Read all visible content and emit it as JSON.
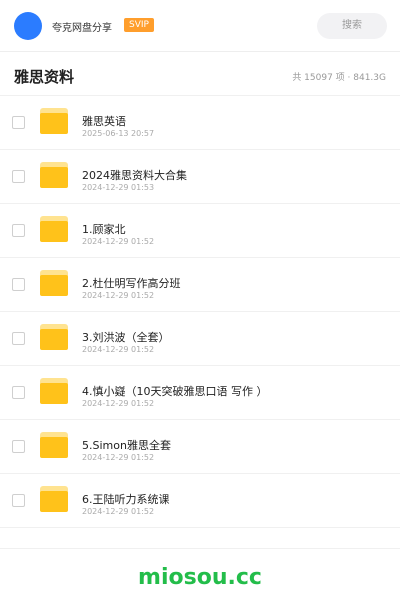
{
  "header": {
    "share_title": "夸克网盘分享",
    "svip_badge": "SVIP",
    "search_label": "搜索"
  },
  "title_bar": {
    "title": "雅思资料",
    "stats": "共 15097 项 · 841.3G"
  },
  "items": [
    {
      "name": "雅思英语",
      "date": "2025-06-13 20:57"
    },
    {
      "name": "2024雅思资料大合集",
      "date": "2024-12-29 01:53"
    },
    {
      "name": "1.顾家北",
      "date": "2024-12-29 01:52"
    },
    {
      "name": "2.杜仕明写作高分班",
      "date": "2024-12-29 01:52"
    },
    {
      "name": "3.刘洪波（全套）",
      "date": "2024-12-29 01:52"
    },
    {
      "name": "4.慎小嶷（10天突破雅思口语 写作 ）",
      "date": "2024-12-29 01:52"
    },
    {
      "name": "5.Simon雅思全套",
      "date": "2024-12-29 01:52"
    },
    {
      "name": "6.王陆听力系统课",
      "date": "2024-12-29 01:52"
    }
  ],
  "footer": {
    "brand": "miosou.cc",
    "brand_color": "#23bd4a"
  },
  "icons": {
    "avatar": "avatar",
    "folder": "folder-icon",
    "checkbox": "checkbox"
  },
  "colors": {
    "avatar": "#2b7cff",
    "svip": "#ff9e2c",
    "folder": "#ffc21a"
  }
}
